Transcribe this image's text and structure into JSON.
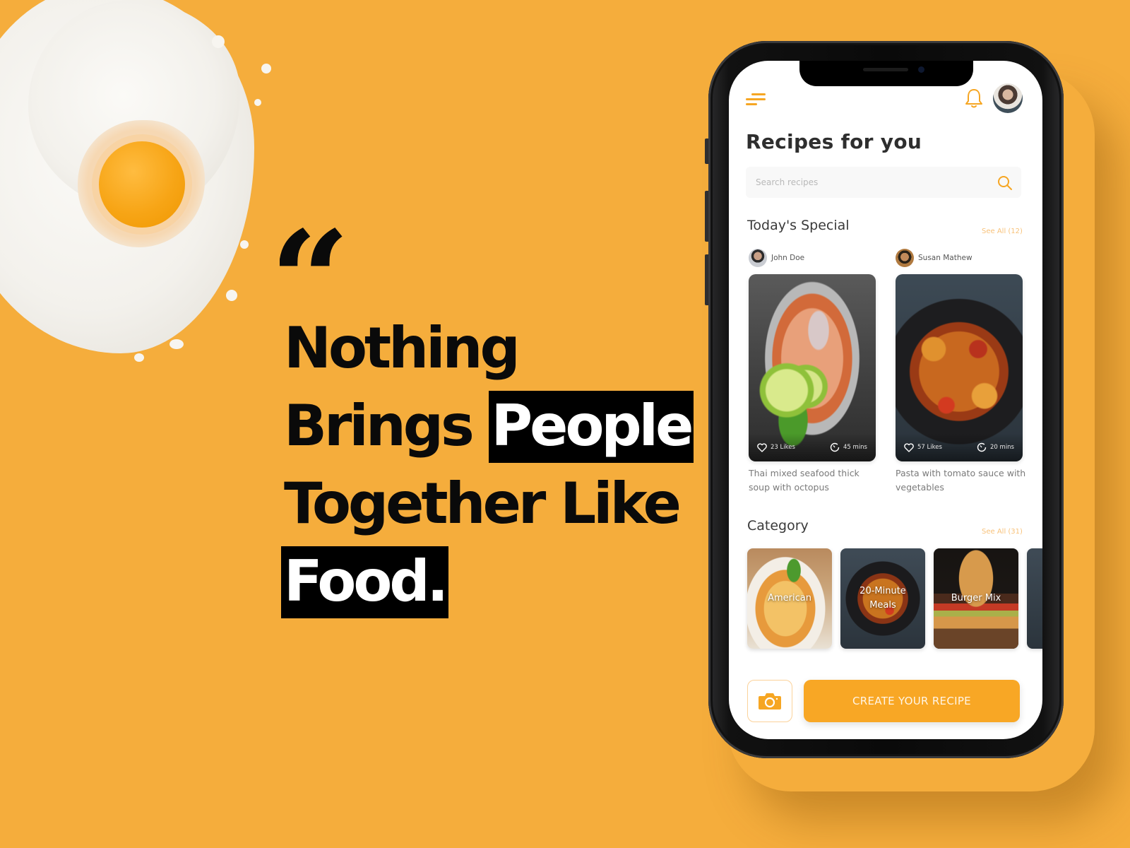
{
  "colors": {
    "background": "#f5ad3c",
    "accent": "#f8a725",
    "highlight_bg": "#000000",
    "highlight_text": "#ffffff"
  },
  "quote": {
    "mark": "“",
    "lines": [
      {
        "plain": "Nothing",
        "highlight": ""
      },
      {
        "plain": "Brings ",
        "highlight": "People"
      },
      {
        "plain": "Together Like",
        "highlight": ""
      },
      {
        "plain": "",
        "highlight": "Food."
      }
    ]
  },
  "app": {
    "header": {
      "menu_icon": "hamburger-menu-icon",
      "notification_icon": "bell-icon",
      "avatar": "user-avatar"
    },
    "title": "Recipes for you",
    "search": {
      "placeholder": "Search recipes",
      "value": "",
      "icon": "search-icon"
    },
    "todays_special": {
      "title": "Today's Special",
      "see_all": "See All (12)",
      "recipes": [
        {
          "author": "John Doe",
          "likes": "23 Likes",
          "time": "45 mins",
          "name": "Thai mixed seafood thick soup with octopus"
        },
        {
          "author": "Susan Mathew",
          "likes": "57 Likes",
          "time": "20 mins",
          "name": "Pasta with tomato sauce with vegetables"
        }
      ]
    },
    "category": {
      "title": "Category",
      "see_all": "See All (31)",
      "items": [
        {
          "label": "American"
        },
        {
          "label": "20-Minute Meals"
        },
        {
          "label": "Burger Mix"
        },
        {
          "label": ""
        }
      ]
    },
    "actions": {
      "camera_icon": "camera-icon",
      "create_label": "CREATE YOUR RECIPE"
    }
  }
}
